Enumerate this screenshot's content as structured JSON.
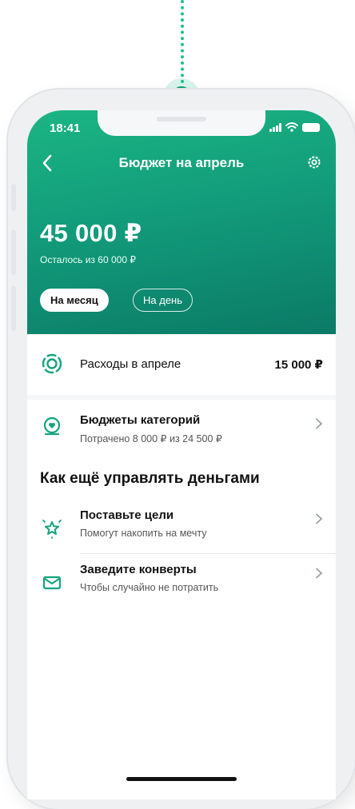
{
  "status_bar": {
    "time": "18:41"
  },
  "header": {
    "title": "Бюджет на апрель",
    "amount": "45 000 ₽",
    "amount_subtitle": "Осталось из 60 000 ₽",
    "tabs": [
      {
        "label": "На месяц",
        "active": true
      },
      {
        "label": "На день",
        "active": false
      }
    ]
  },
  "spending": {
    "label": "Расходы в апреле",
    "value": "15 000 ₽"
  },
  "category_budgets": {
    "title": "Бюджеты категорий",
    "subtitle": "Потрачено 8 000 ₽ из 24 500 ₽"
  },
  "section": {
    "title": "Как ещё управлять деньгами",
    "items": [
      {
        "title": "Поставьте цели",
        "subtitle": "Помогут накопить на мечту",
        "icon": "star-sparkle-icon"
      },
      {
        "title": "Заведите конверты",
        "subtitle": "Чтобы случайно не потратить",
        "icon": "envelope-icon"
      }
    ]
  },
  "colors": {
    "accent": "#14a37f",
    "header_gradient_start": "#1bb583",
    "header_gradient_end": "#0b7a66"
  }
}
